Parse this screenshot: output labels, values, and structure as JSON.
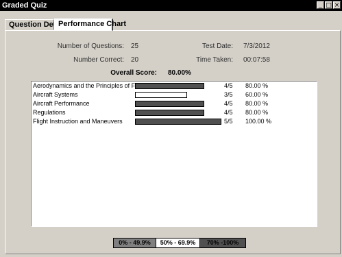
{
  "window": {
    "title": "Graded Quiz",
    "buttons": [
      "_",
      "□",
      "×"
    ]
  },
  "tabs": [
    {
      "label": "Question Detail",
      "active": false
    },
    {
      "label": "Performance Chart",
      "active": true
    }
  ],
  "summary": {
    "num_questions_label": "Number of Questions:",
    "num_questions": "25",
    "num_correct_label": "Number Correct:",
    "num_correct": "20",
    "test_date_label": "Test Date:",
    "test_date": "7/3/2012",
    "time_taken_label": "Time Taken:",
    "time_taken": "00:07:58",
    "overall_label": "Overall Score:",
    "overall": "80.00%"
  },
  "categories": [
    {
      "name": "Aerodynamics and the Principles of Flight",
      "fraction": "4/5",
      "percent": "80.00 %",
      "value": 0.8,
      "band": "high"
    },
    {
      "name": "Aircraft Systems",
      "fraction": "3/5",
      "percent": "60.00 %",
      "value": 0.6,
      "band": "mid"
    },
    {
      "name": "Aircraft Performance",
      "fraction": "4/5",
      "percent": "80.00 %",
      "value": 0.8,
      "band": "high"
    },
    {
      "name": "Regulations",
      "fraction": "4/5",
      "percent": "80.00 %",
      "value": 0.8,
      "band": "high"
    },
    {
      "name": "Flight Instruction and Maneuvers",
      "fraction": "5/5",
      "percent": "100.00 %",
      "value": 1.0,
      "band": "high"
    }
  ],
  "legend": [
    {
      "label": "0% - 49.9%",
      "band": "low"
    },
    {
      "label": "50% - 69.9%",
      "band": "mid"
    },
    {
      "label": "70% -100%",
      "band": "high"
    }
  ],
  "colors": {
    "low": "#808080",
    "mid": "#ffffff",
    "high": "#505050",
    "high_text": "#000000"
  }
}
